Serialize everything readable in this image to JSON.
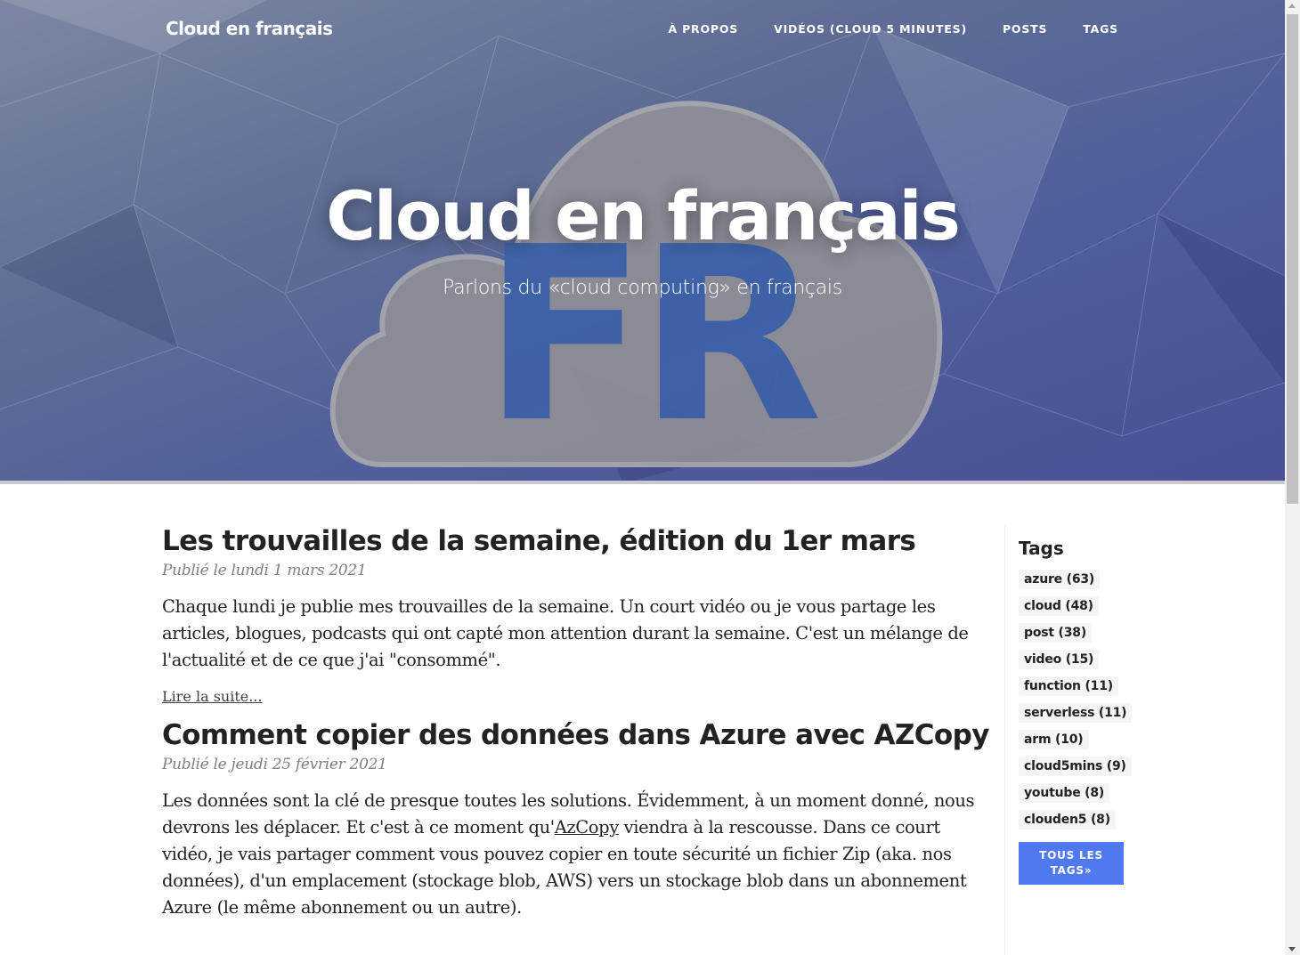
{
  "nav": {
    "brand": "Cloud en français",
    "links": [
      "À PROPOS",
      "VIDÉOS (CLOUD 5 MINUTES)",
      "POSTS",
      "TAGS"
    ]
  },
  "hero": {
    "title": "Cloud en français",
    "subtitle": "Parlons du «cloud computing» en français",
    "logo_text": "FR"
  },
  "posts": [
    {
      "title": "Les trouvailles de la semaine, édition du 1er mars",
      "meta": "Publié le lundi 1 mars 2021",
      "excerpt": "Chaque lundi je publie mes trouvailles de la semaine. Un court vidéo ou je vous partage les articles, blogues, podcasts qui ont capté mon attention durant la semaine. C'est un mélange de l'actualité et de ce que j'ai \"consommé\".",
      "read_more": "Lire la suite..."
    },
    {
      "title": "Comment copier des données dans Azure avec AZCopy",
      "meta": "Publié le jeudi 25 février 2021",
      "excerpt_before": "Les données sont la clé de presque toutes les solutions. Évidemment, à un moment donné, nous devrons les déplacer. Et c'est à ce moment qu'",
      "excerpt_link": "AzCopy",
      "excerpt_after": " viendra à la rescousse. Dans ce court vidéo, je vais partager comment vous pouvez copier en toute sécurité un fichier Zip (aka. nos données), d'un emplacement (stockage blob, AWS) vers un stockage blob dans un abonnement Azure (le même abonnement ou un autre)."
    }
  ],
  "sidebar": {
    "title": "Tags",
    "tags": [
      "azure (63)",
      "cloud (48)",
      "post (38)",
      "video (15)",
      "function (11)",
      "serverless (11)",
      "arm (10)",
      "cloud5mins (9)",
      "youtube (8)",
      "clouden5 (8)"
    ],
    "all_tags_label": "TOUS LES TAGS»"
  },
  "colors": {
    "accent": "#5079f0",
    "hero_blue": "#4f5d9c",
    "logo_fr": "#3d62a8"
  }
}
